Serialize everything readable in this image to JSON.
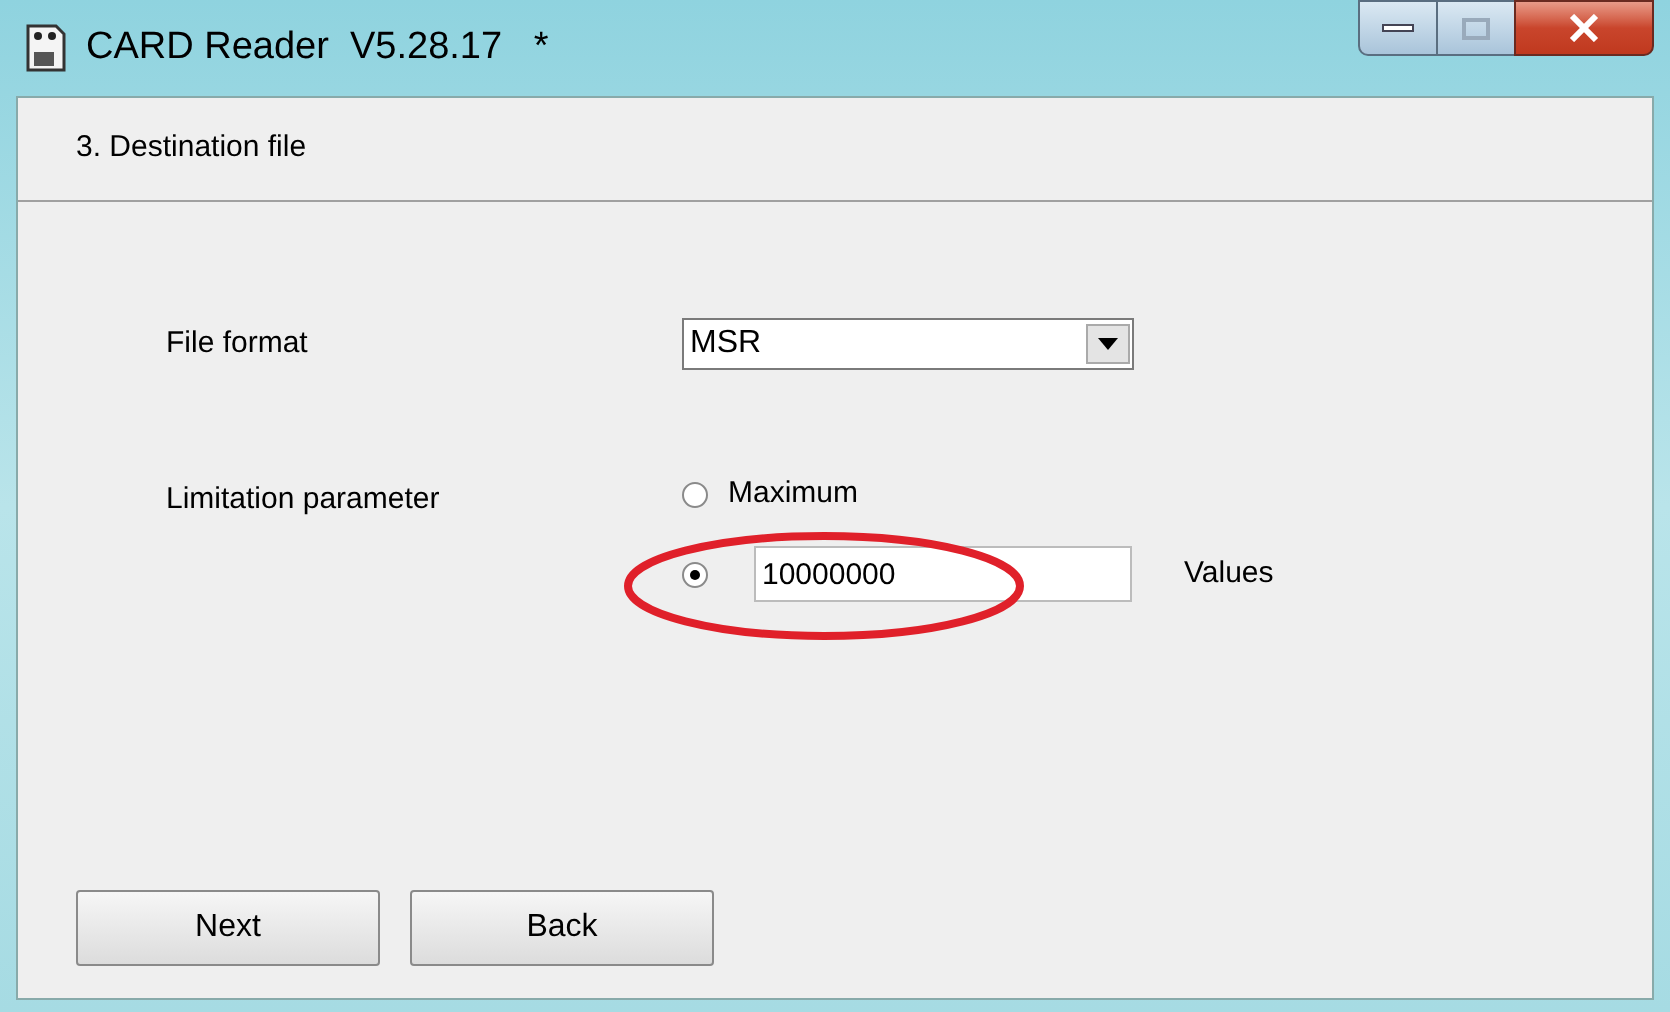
{
  "window": {
    "title": "CARD Reader  V5.28.17   *"
  },
  "step_title": "3. Destination file",
  "file_format": {
    "label": "File format",
    "value": "MSR"
  },
  "limitation": {
    "label": "Limitation parameter",
    "options": [
      {
        "kind": "label",
        "label": "Maximum",
        "selected": false
      },
      {
        "kind": "field",
        "value": "10000000",
        "selected": true
      }
    ],
    "unit": "Values"
  },
  "buttons": [
    "Next",
    "Back"
  ]
}
